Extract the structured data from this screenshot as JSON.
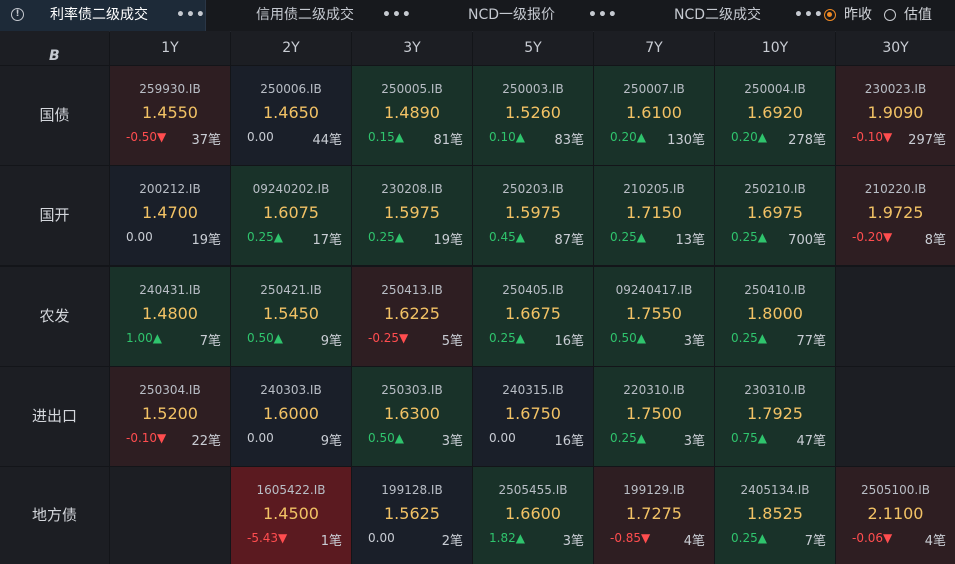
{
  "tabs": [
    {
      "label": "利率债二级成交",
      "more": "•••",
      "active": true
    },
    {
      "label": "信用债二级成交",
      "more": "•••",
      "active": false
    },
    {
      "label": "NCD一级报价",
      "more": "•••",
      "active": false
    },
    {
      "label": "NCD二级成交",
      "more": "•••",
      "active": false
    }
  ],
  "radios": [
    {
      "label": "昨收",
      "checked": true
    },
    {
      "label": "估值",
      "checked": false
    }
  ],
  "corner_icon": "B",
  "terms": [
    "1Y",
    "2Y",
    "3Y",
    "5Y",
    "7Y",
    "10Y",
    "30Y"
  ],
  "colors": {
    "up_bg": "#193229",
    "down_bg": "#2e1e22",
    "flat_bg": "#1a1f29",
    "strong_down_bg": "#5b1a20",
    "empty_bg": "#1c1e23"
  },
  "rows": [
    {
      "name": "国债",
      "cells": [
        {
          "code": "259930.IB",
          "rate": "1.4550",
          "chg": "-0.50▼",
          "dir": "down",
          "count": "37笔"
        },
        {
          "code": "250006.IB",
          "rate": "1.4650",
          "chg": "0.00",
          "dir": "flat",
          "count": "44笔"
        },
        {
          "code": "250005.IB",
          "rate": "1.4890",
          "chg": "0.15▲",
          "dir": "up",
          "count": "81笔"
        },
        {
          "code": "250003.IB",
          "rate": "1.5260",
          "chg": "0.10▲",
          "dir": "up",
          "count": "83笔"
        },
        {
          "code": "250007.IB",
          "rate": "1.6100",
          "chg": "0.20▲",
          "dir": "up",
          "count": "130笔"
        },
        {
          "code": "250004.IB",
          "rate": "1.6920",
          "chg": "0.20▲",
          "dir": "up",
          "count": "278笔"
        },
        {
          "code": "230023.IB",
          "rate": "1.9090",
          "chg": "-0.10▼",
          "dir": "down",
          "count": "297笔"
        }
      ]
    },
    {
      "name": "国开",
      "cells": [
        {
          "code": "200212.IB",
          "rate": "1.4700",
          "chg": "0.00",
          "dir": "flat",
          "count": "19笔"
        },
        {
          "code": "09240202.IB",
          "rate": "1.6075",
          "chg": "0.25▲",
          "dir": "up",
          "count": "17笔"
        },
        {
          "code": "230208.IB",
          "rate": "1.5975",
          "chg": "0.25▲",
          "dir": "up",
          "count": "19笔"
        },
        {
          "code": "250203.IB",
          "rate": "1.5975",
          "chg": "0.45▲",
          "dir": "up",
          "count": "87笔"
        },
        {
          "code": "210205.IB",
          "rate": "1.7150",
          "chg": "0.25▲",
          "dir": "up",
          "count": "13笔"
        },
        {
          "code": "250210.IB",
          "rate": "1.6975",
          "chg": "0.25▲",
          "dir": "up",
          "count": "700笔"
        },
        {
          "code": "210220.IB",
          "rate": "1.9725",
          "chg": "-0.20▼",
          "dir": "down",
          "count": "8笔"
        }
      ]
    },
    {
      "name": "农发",
      "cells": [
        {
          "code": "240431.IB",
          "rate": "1.4800",
          "chg": "1.00▲",
          "dir": "up",
          "count": "7笔"
        },
        {
          "code": "250421.IB",
          "rate": "1.5450",
          "chg": "0.50▲",
          "dir": "up",
          "count": "9笔"
        },
        {
          "code": "250413.IB",
          "rate": "1.6225",
          "chg": "-0.25▼",
          "dir": "down",
          "count": "5笔"
        },
        {
          "code": "250405.IB",
          "rate": "1.6675",
          "chg": "0.25▲",
          "dir": "up",
          "count": "16笔"
        },
        {
          "code": "09240417.IB",
          "rate": "1.7550",
          "chg": "0.50▲",
          "dir": "up",
          "count": "3笔"
        },
        {
          "code": "250410.IB",
          "rate": "1.8000",
          "chg": "0.25▲",
          "dir": "up",
          "count": "77笔"
        },
        null
      ]
    },
    {
      "name": "进出口",
      "cells": [
        {
          "code": "250304.IB",
          "rate": "1.5200",
          "chg": "-0.10▼",
          "dir": "down",
          "count": "22笔"
        },
        {
          "code": "240303.IB",
          "rate": "1.6000",
          "chg": "0.00",
          "dir": "flat",
          "count": "9笔"
        },
        {
          "code": "250303.IB",
          "rate": "1.6300",
          "chg": "0.50▲",
          "dir": "up",
          "count": "3笔"
        },
        {
          "code": "240315.IB",
          "rate": "1.6750",
          "chg": "0.00",
          "dir": "flat",
          "count": "16笔"
        },
        {
          "code": "220310.IB",
          "rate": "1.7500",
          "chg": "0.25▲",
          "dir": "up",
          "count": "3笔"
        },
        {
          "code": "230310.IB",
          "rate": "1.7925",
          "chg": "0.75▲",
          "dir": "up",
          "count": "47笔"
        },
        null
      ]
    },
    {
      "name": "地方债",
      "cells": [
        null,
        {
          "code": "1605422.IB",
          "rate": "1.4500",
          "chg": "-5.43▼",
          "dir": "strong_down",
          "count": "1笔"
        },
        {
          "code": "199128.IB",
          "rate": "1.5625",
          "chg": "0.00",
          "dir": "flat",
          "count": "2笔"
        },
        {
          "code": "2505455.IB",
          "rate": "1.6600",
          "chg": "1.82▲",
          "dir": "up",
          "count": "3笔"
        },
        {
          "code": "199129.IB",
          "rate": "1.7275",
          "chg": "-0.85▼",
          "dir": "down",
          "count": "4笔"
        },
        {
          "code": "2405134.IB",
          "rate": "1.8525",
          "chg": "0.25▲",
          "dir": "up",
          "count": "7笔"
        },
        {
          "code": "2505100.IB",
          "rate": "2.1100",
          "chg": "-0.06▼",
          "dir": "down",
          "count": "4笔"
        }
      ]
    }
  ]
}
